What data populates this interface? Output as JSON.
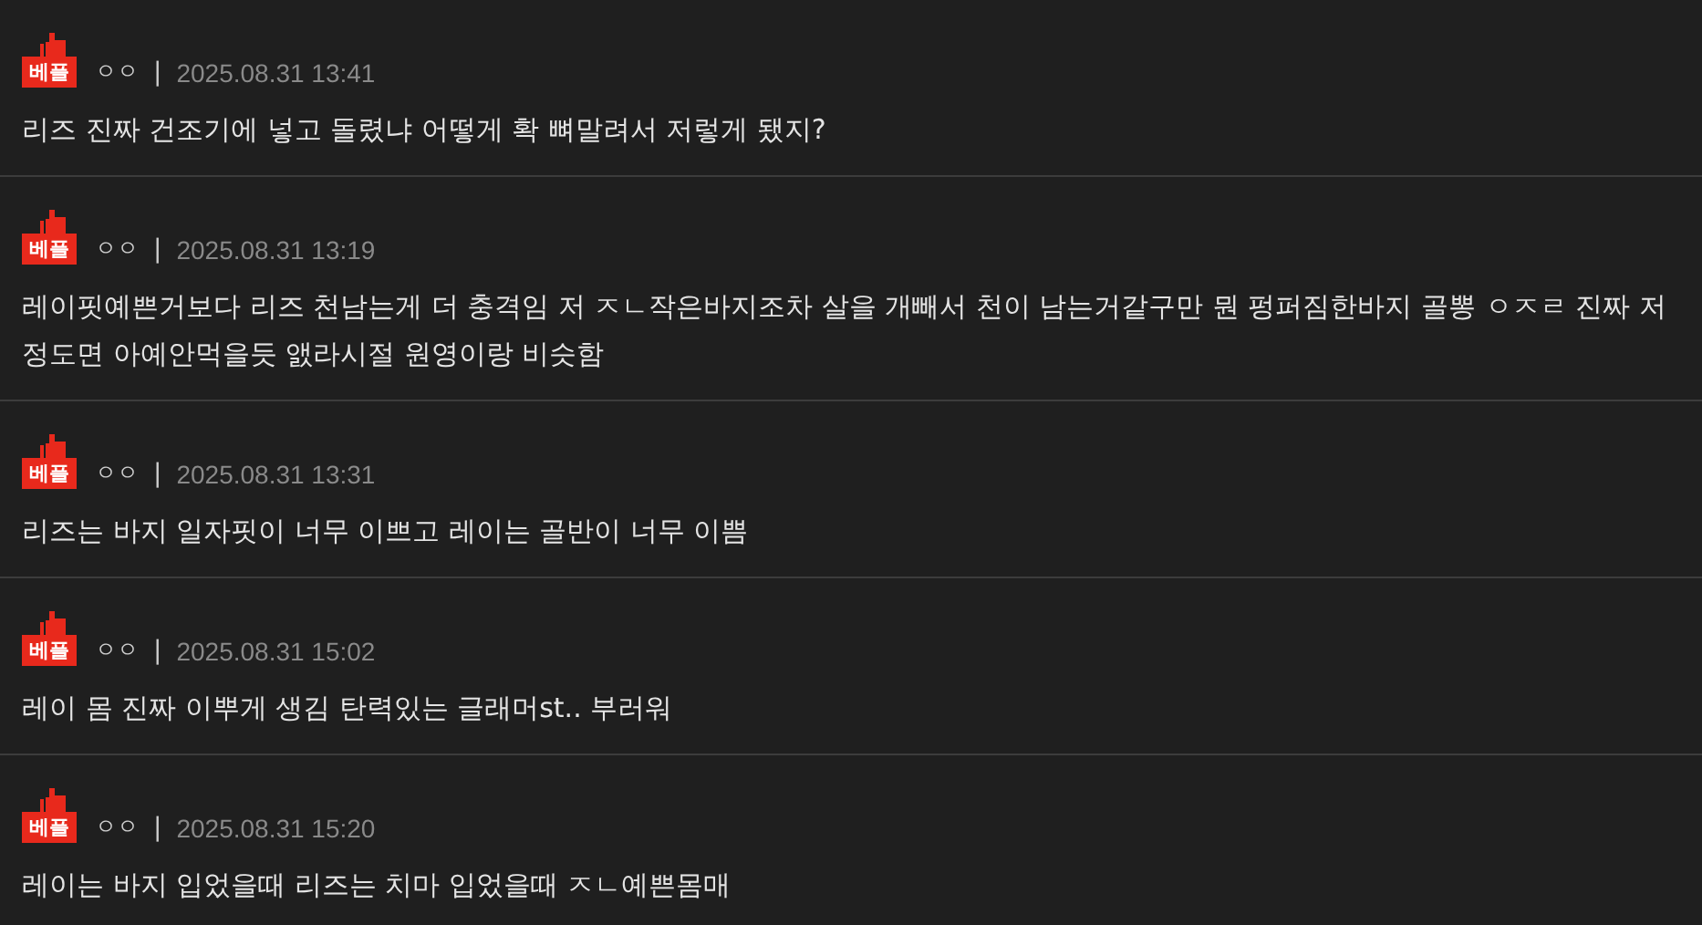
{
  "comments": [
    {
      "badge": "베플",
      "author": "ㅇㅇ",
      "separator": "|",
      "date": "2025.08.31 13:41",
      "text": "리즈 진짜 건조기에 넣고 돌렸냐 어떻게 확 뼈말려서 저렇게 됐지?"
    },
    {
      "badge": "베플",
      "author": "ㅇㅇ",
      "separator": "|",
      "date": "2025.08.31 13:19",
      "text": "레이핏예쁜거보다 리즈 천남는게 더 충격임 저 ㅈㄴ작은바지조차 살을 개빼서 천이 남는거같구만 뭔 펑퍼짐한바지 골뽕 ㅇㅈㄹ 진짜 저정도면 아예안먹을듯 앬라시절 원영이랑 비슷함"
    },
    {
      "badge": "베플",
      "author": "ㅇㅇ",
      "separator": "|",
      "date": "2025.08.31 13:31",
      "text": "리즈는 바지 일자핏이 너무 이쁘고 레이는 골반이 너무 이쁨"
    },
    {
      "badge": "베플",
      "author": "ㅇㅇ",
      "separator": "|",
      "date": "2025.08.31 15:02",
      "text": "레이 몸 진짜 이뿌게 생김 탄력있는 글래머st.. 부러워"
    },
    {
      "badge": "베플",
      "author": "ㅇㅇ",
      "separator": "|",
      "date": "2025.08.31 15:20",
      "text": "레이는 바지 입었을때 리즈는 치마 입었을때 ㅈㄴ예쁜몸매"
    }
  ]
}
